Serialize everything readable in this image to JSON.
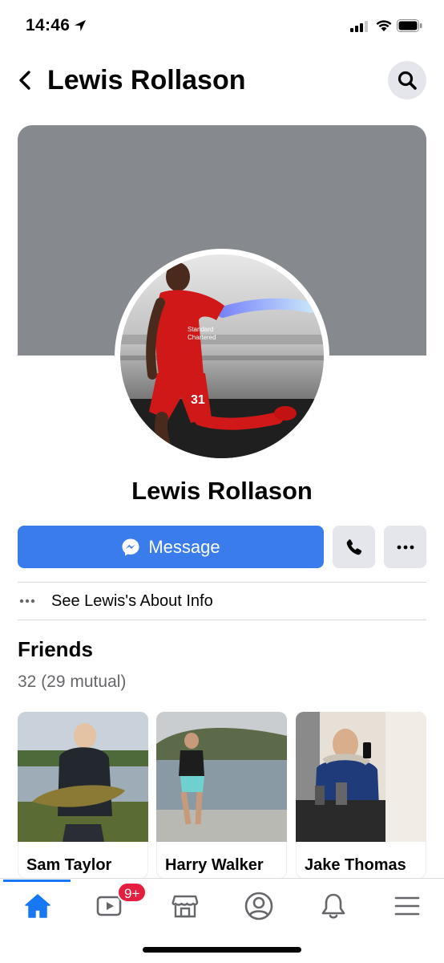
{
  "status_bar": {
    "time": "14:46"
  },
  "header": {
    "title": "Lewis Rollason"
  },
  "profile": {
    "name": "Lewis Rollason",
    "message_label": "Message",
    "about_label": "See Lewis's About Info"
  },
  "friends": {
    "title": "Friends",
    "count": "32 (29 mutual)",
    "items": [
      {
        "name": "Sam Taylor"
      },
      {
        "name": "Harry Walker"
      },
      {
        "name": "Jake Thomas"
      }
    ]
  },
  "nav": {
    "items": [
      {
        "icon": "home-icon",
        "active": true
      },
      {
        "icon": "watch-icon",
        "badge": "9+"
      },
      {
        "icon": "marketplace-icon"
      },
      {
        "icon": "profile-icon"
      },
      {
        "icon": "bell-icon"
      },
      {
        "icon": "menu-icon"
      }
    ]
  },
  "colors": {
    "accent": "#1877f2",
    "message_button": "#3b7cec",
    "cover": "#86898e",
    "badge": "#e41e3f"
  }
}
